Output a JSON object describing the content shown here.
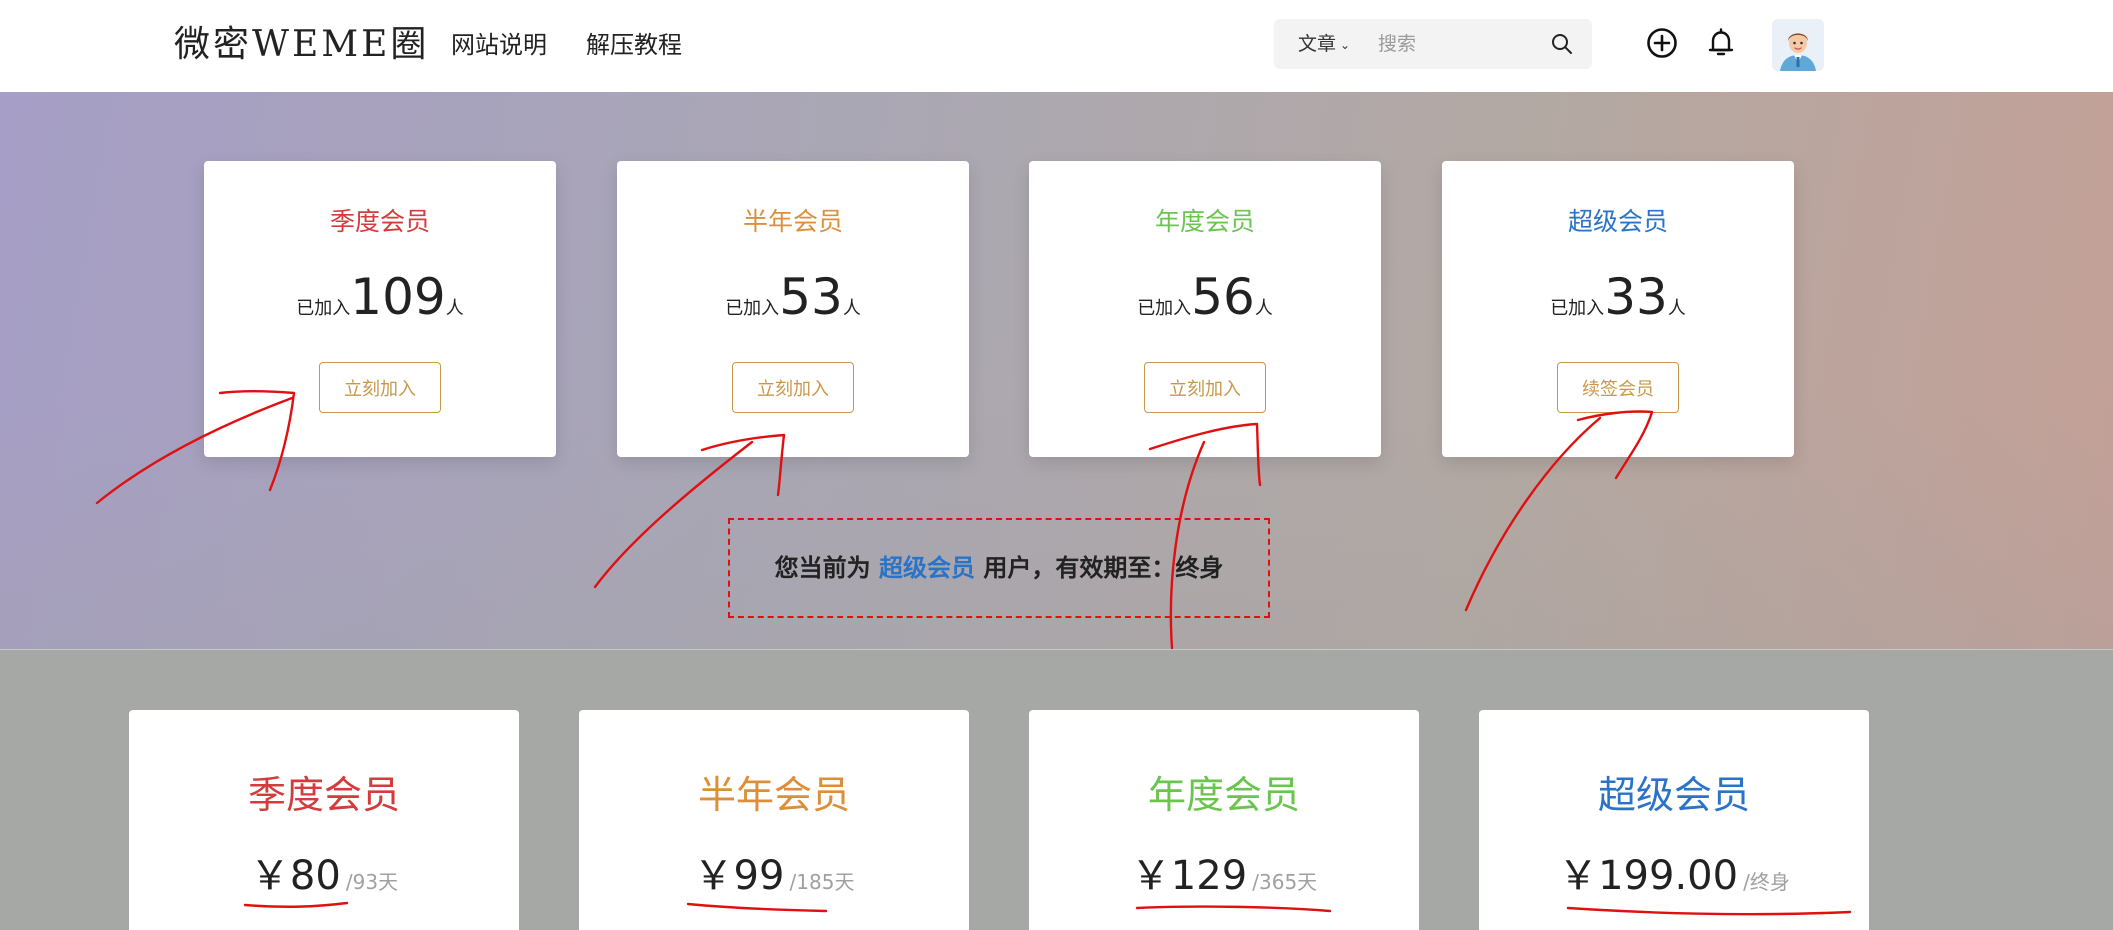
{
  "header": {
    "logo": "微密WEME圈",
    "nav": [
      "网站说明",
      "解压教程"
    ],
    "search": {
      "type_label": "文章",
      "placeholder": "搜索"
    }
  },
  "membership_cards": [
    {
      "title": "季度会员",
      "joined_prefix": "已加入",
      "count": "109",
      "suffix": "人",
      "button": "立刻加入",
      "color": "#d23c3c"
    },
    {
      "title": "半年会员",
      "joined_prefix": "已加入",
      "count": "53",
      "suffix": "人",
      "button": "立刻加入",
      "color": "#dc8f38"
    },
    {
      "title": "年度会员",
      "joined_prefix": "已加入",
      "count": "56",
      "suffix": "人",
      "button": "立刻加入",
      "color": "#6bc450"
    },
    {
      "title": "超级会员",
      "joined_prefix": "已加入",
      "count": "33",
      "suffix": "人",
      "button": "续签会员",
      "color": "#2a73c6"
    }
  ],
  "status": {
    "prefix": "您当前为",
    "level": "超级会员",
    "middle": "用户，有效期至：",
    "expiry": "终身"
  },
  "pricing_cards": [
    {
      "title": "季度会员",
      "price": "￥80",
      "period": "/93天",
      "color": "#d23c3c"
    },
    {
      "title": "半年会员",
      "price": "￥99",
      "period": "/185天",
      "color": "#dc8f38"
    },
    {
      "title": "年度会员",
      "price": "￥129",
      "period": "/365天",
      "color": "#6bc450"
    },
    {
      "title": "超级会员",
      "price": "￥199.00",
      "period": "/终身",
      "color": "#2a73c6"
    }
  ],
  "icons": {
    "add": "plus-circle-icon",
    "notifications": "bell-icon",
    "search": "search-icon",
    "dropdown": "chevron-down-icon",
    "avatar": "user-avatar"
  },
  "colors": {
    "accent_button": "#c9974a",
    "annotation": "#e01010"
  }
}
